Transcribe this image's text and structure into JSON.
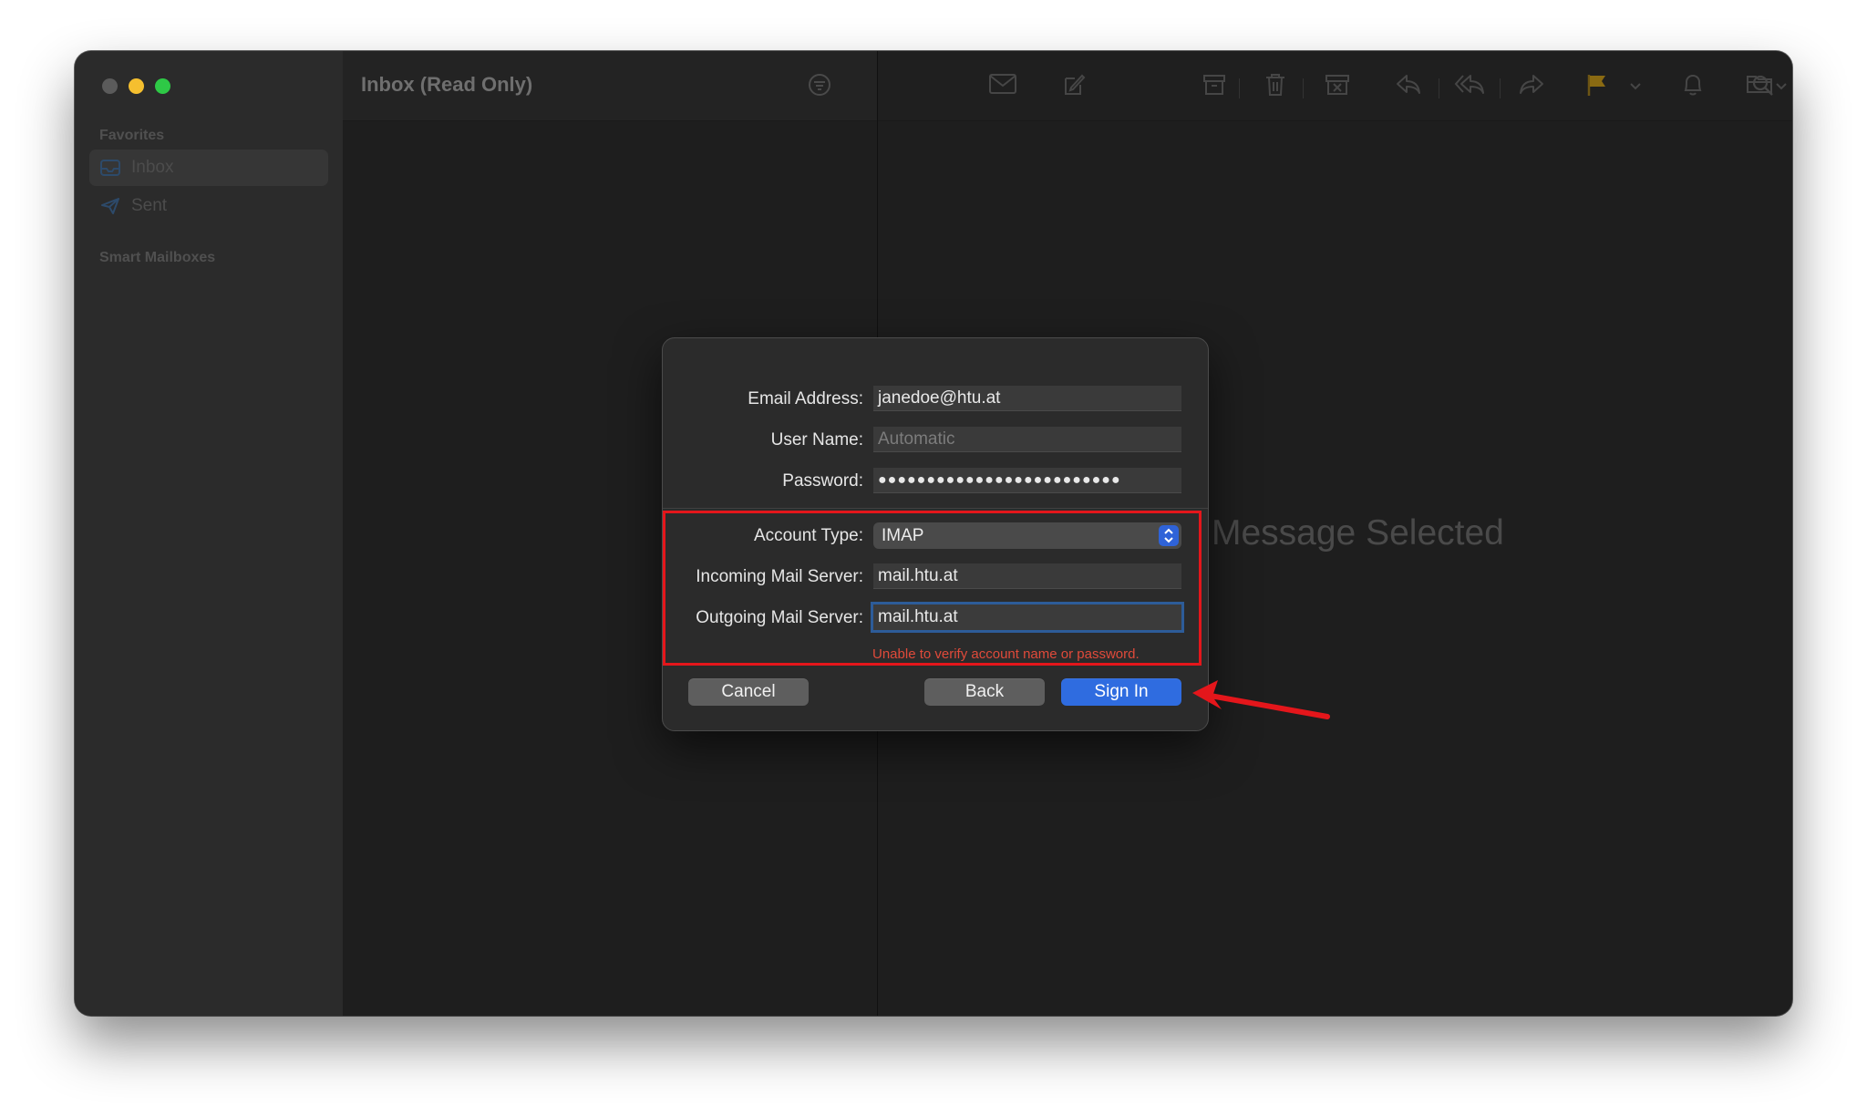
{
  "window": {
    "title": "Inbox (Read Only)"
  },
  "sidebar": {
    "favorites_header": "Favorites",
    "items": [
      {
        "label": "Inbox",
        "icon": "inbox-tray-icon",
        "selected": true
      },
      {
        "label": "Sent",
        "icon": "paper-plane-icon",
        "selected": false
      }
    ],
    "smart_header": "Smart Mailboxes"
  },
  "toolbar": {
    "icons": [
      "filter-icon",
      "envelope-icon",
      "compose-icon",
      "archive-icon",
      "trash-icon",
      "junk-icon",
      "reply-icon",
      "reply-all-icon",
      "forward-icon",
      "flag-icon",
      "chevron-down-icon",
      "bell-icon",
      "folder-icon",
      "search-icon"
    ]
  },
  "viewer": {
    "empty_text": "Message Selected"
  },
  "dialog": {
    "email_label": "Email Address:",
    "email_value": "janedoe@htu.at",
    "username_label": "User Name:",
    "username_placeholder": "Automatic",
    "password_label": "Password:",
    "password_value": "●●●●●●●●●●●●●●●●●●●●●●●●●",
    "account_type_label": "Account Type:",
    "account_type_value": "IMAP",
    "incoming_label": "Incoming Mail Server:",
    "incoming_value": "mail.htu.at",
    "outgoing_label": "Outgoing Mail Server:",
    "outgoing_value": "mail.htu.at",
    "error": "Unable to verify account name or password.",
    "cancel_label": "Cancel",
    "back_label": "Back",
    "signin_label": "Sign In"
  },
  "colors": {
    "accent": "#2f6ce0",
    "error": "#e04a3a",
    "annotation": "#e4161b",
    "flag": "#d9a21c"
  }
}
